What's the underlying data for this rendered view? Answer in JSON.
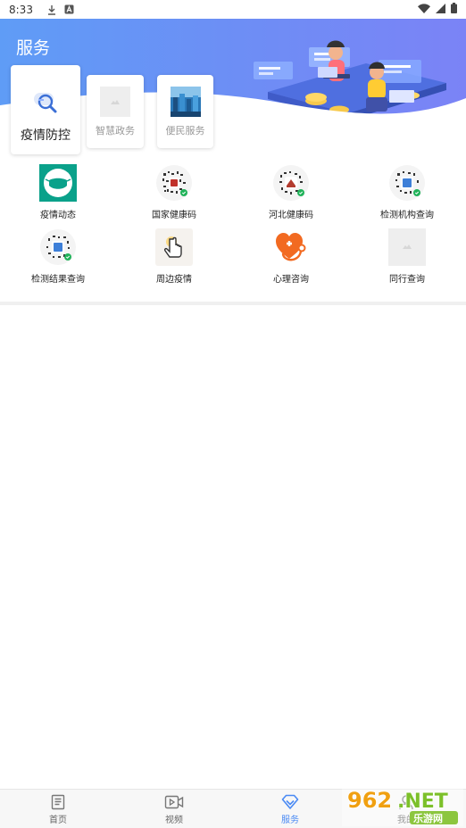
{
  "status_bar": {
    "time": "8:33"
  },
  "header": {
    "title": "服务"
  },
  "categories": [
    {
      "label": "疫情防控"
    },
    {
      "label": "智慧政务"
    },
    {
      "label": "便民服务"
    }
  ],
  "services": [
    {
      "label": "疫情动态"
    },
    {
      "label": "国家健康码"
    },
    {
      "label": "河北健康码"
    },
    {
      "label": "检测机构查询"
    },
    {
      "label": "检测结果查询"
    },
    {
      "label": "周边疫情"
    },
    {
      "label": "心理咨询"
    },
    {
      "label": "同行查询"
    }
  ],
  "tabbar": [
    {
      "label": "首页"
    },
    {
      "label": "视频"
    },
    {
      "label": "服务"
    },
    {
      "label": "我的"
    }
  ],
  "watermark": {
    "text_a": "962",
    "text_b": ".NET",
    "text_c": "乐游网"
  },
  "colors": {
    "accent": "#4a8af4",
    "hero_start": "#5f9cf6",
    "hero_end": "#7b83f6",
    "mask_green": "#0aa18a",
    "heart_orange": "#f26a21"
  }
}
